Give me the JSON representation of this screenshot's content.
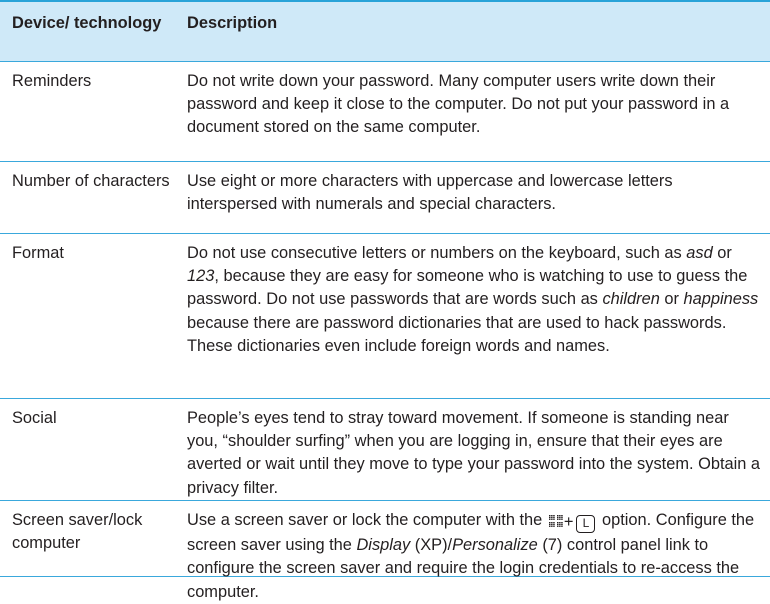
{
  "table": {
    "headers": {
      "col1": "Device/ technology",
      "col2": "Description"
    },
    "rows": [
      {
        "device": "Reminders",
        "description": [
          {
            "text": "Do not write down your password. Many computer users write down their password and keep it close to the computer. Do not put your password in a document stored on the same computer.",
            "italic": false
          }
        ]
      },
      {
        "device": "Number of characters",
        "description": [
          {
            "text": "Use eight or more characters with uppercase and lowercase letters interspersed with numerals and special characters.",
            "italic": false
          }
        ]
      },
      {
        "device": "Format",
        "description": [
          {
            "text": "Do not use consecutive letters or numbers on the keyboard, such as ",
            "italic": false
          },
          {
            "text": "asd",
            "italic": true
          },
          {
            "text": " or ",
            "italic": false
          },
          {
            "text": "123",
            "italic": true
          },
          {
            "text": ", because they are easy for someone who is watching to use to guess the password. Do not use passwords that are words such as ",
            "italic": false
          },
          {
            "text": "children",
            "italic": true
          },
          {
            "text": " or ",
            "italic": false
          },
          {
            "text": "happiness",
            "italic": true
          },
          {
            "text": " because there are password dictionaries that are used to hack passwords. These dictionaries even include foreign words and names.",
            "italic": false
          }
        ]
      },
      {
        "device": "Social",
        "description": [
          {
            "text": "People’s eyes tend to stray toward movement. If someone is standing near you, “shoulder surfing” when you are logging in, ensure that their eyes are averted or wait until they move to type your password into the system. Obtain a privacy filter.",
            "italic": false
          }
        ]
      },
      {
        "device": "Screen saver/lock computer",
        "description": [
          {
            "text": "Use a screen saver or lock the computer with the ",
            "italic": false
          },
          {
            "text": "+",
            "italic": false,
            "keycombo": true,
            "key": "L"
          },
          {
            "text": " option. Configure the screen saver using the ",
            "italic": false
          },
          {
            "text": "Display",
            "italic": true
          },
          {
            "text": " (XP)/",
            "italic": false
          },
          {
            "text": "Personalize",
            "italic": true
          },
          {
            "text": " (7) control panel link to configure the screen saver and require the login credentials to re-access the computer.",
            "italic": false
          }
        ]
      }
    ]
  },
  "colors": {
    "header_bg": "#cfe9f8",
    "rule": "#3aa8dc",
    "text": "#231f20"
  },
  "icons": {
    "windows_key": "windows-logo-icon",
    "l_key": "keyboard-key-icon"
  }
}
